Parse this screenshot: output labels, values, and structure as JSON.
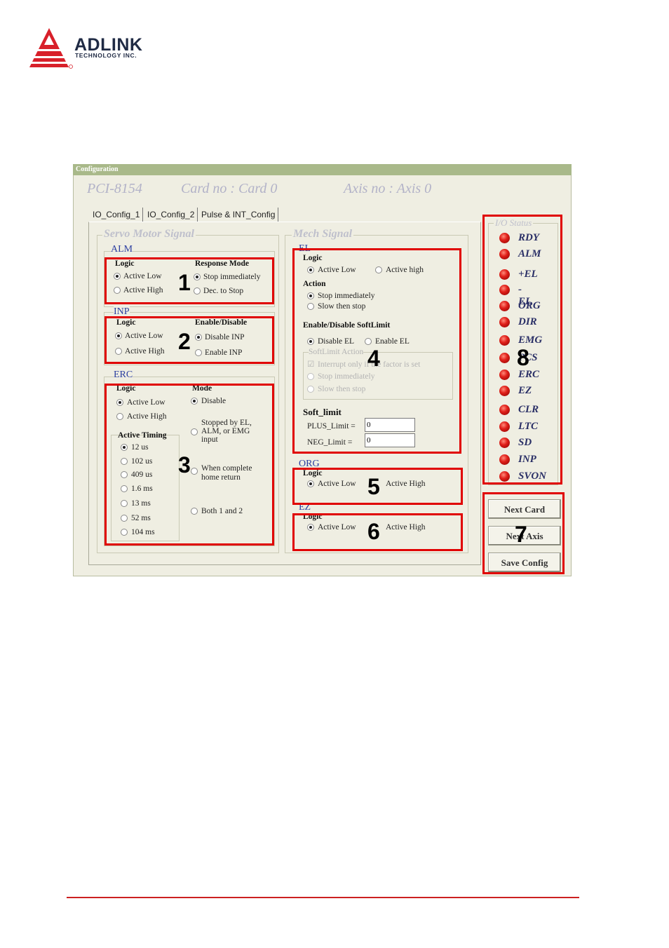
{
  "logo": {
    "name": "ADLINK",
    "sub": "TECHNOLOGY INC."
  },
  "window": {
    "title": "Configuration",
    "card_model": "PCI-8154",
    "card_no": "Card no : Card  0",
    "axis_no": "Axis no : Axis  0"
  },
  "tabs": [
    "IO_Config_1",
    "IO_Config_2",
    "Pulse & INT_Config"
  ],
  "servo": {
    "title": "Servo Motor Signal",
    "alm": {
      "title": "ALM",
      "logic_label": "Logic",
      "logic": [
        "Active Low",
        "Active High"
      ],
      "response_label": "Response Mode",
      "response": [
        "Stop immediately",
        "Dec. to Stop"
      ]
    },
    "inp": {
      "title": "INP",
      "logic_label": "Logic",
      "logic": [
        "Active Low",
        "Active High"
      ],
      "enable_label": "Enable/Disable",
      "enable": [
        "Disable INP",
        "Enable INP"
      ]
    },
    "erc": {
      "title": "ERC",
      "logic_label": "Logic",
      "logic": [
        "Active Low",
        "Active High"
      ],
      "timing_label": "Active Timing",
      "timing": [
        "12 us",
        "102 us",
        "409 us",
        "1.6 ms",
        "13 ms",
        "52 ms",
        "104 ms"
      ],
      "mode_label": "Mode",
      "mode": [
        "Disable",
        "Stopped by EL, ALM, or EMG input",
        "When complete home return",
        "Both 1 and 2"
      ]
    }
  },
  "mech": {
    "title": "Mech Signal",
    "el": {
      "title": "EL",
      "logic_label": "Logic",
      "logic": [
        "Active Low",
        "Active high"
      ],
      "action_label": "Action",
      "action": [
        "Stop immediately",
        "Slow then stop"
      ],
      "softlimit_label": "Enable/Disable SoftLimit",
      "softlimit": [
        "Disable  EL",
        "Enable  EL"
      ],
      "softlimit_action_label": "SoftLimit Action",
      "softlimit_action": [
        "Interrupt only if the factor is set",
        "Stop immediately",
        "Slow then stop"
      ]
    },
    "soft_limit": {
      "title": "Soft_limit",
      "plus_label": "PLUS_Limit =",
      "plus_value": "0",
      "neg_label": "NEG_Limit =",
      "neg_value": "0"
    },
    "org": {
      "title": "ORG",
      "logic_label": "Logic",
      "options": [
        "Active Low",
        "Active High"
      ]
    },
    "ez": {
      "title": "EZ",
      "logic_label": "Logic",
      "options": [
        "Active Low",
        "Active High"
      ]
    }
  },
  "io_status": {
    "title": "I/O Status",
    "signals": [
      "RDY",
      "ALM",
      "+EL",
      "-EL",
      "ORG",
      "DIR",
      "EMG",
      "PCS",
      "ERC",
      "EZ",
      "CLR",
      "LTC",
      "SD",
      "INP",
      "SVON"
    ]
  },
  "buttons": {
    "next_card": "Next Card",
    "next_axis": "Next Axis",
    "save_config": "Save Config"
  },
  "markers": [
    "1",
    "2",
    "3",
    "4",
    "5",
    "6",
    "7",
    "8"
  ]
}
